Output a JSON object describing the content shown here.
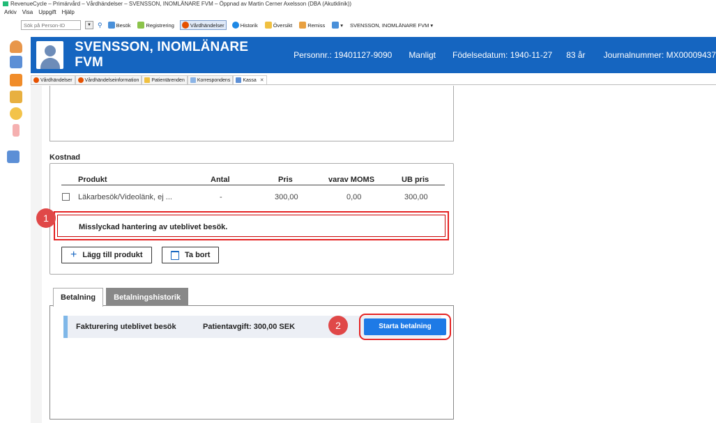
{
  "window": {
    "title": "RevenueCycle – Primärvård – Vårdhändelser – SVENSSON, INOMLÄNARE FVM – Öppnad av Martin Cerner Axelsson (DBA (Akutklinik))"
  },
  "menu": [
    "Arkiv",
    "Visa",
    "Uppgift",
    "Hjälp"
  ],
  "toolbar": {
    "search_placeholder": "Sök på Person-ID",
    "items": [
      "Besök",
      "Registrering",
      "Vårdhändelser",
      "Historik",
      "Översikt",
      "Remiss"
    ],
    "patient_selector": "SVENSSON, INOMLÄNARE FVM"
  },
  "header": {
    "name": "SVENSSON, INOMLÄNARE FVM",
    "personnr": "Personnr.: 19401127-9090",
    "gender": "Manligt",
    "birth": "Födelsedatum: 1940-11-27",
    "age": "83 år",
    "journal": "Journalnummer: MX00009437"
  },
  "tabs": [
    "Vårdhändelser",
    "Vårdhändelseinformation",
    "Patientärenden",
    "Korrespondens",
    "Kassa"
  ],
  "kostnad": {
    "title": "Kostnad",
    "headers": [
      "Produkt",
      "Antal",
      "Pris",
      "varav MOMS",
      "UB pris"
    ],
    "row": [
      "Läkarbesök/Videolänk, ej ...",
      "-",
      "300,00",
      "0,00",
      "300,00"
    ],
    "error": "Misslyckad hantering av uteblivet besök.",
    "add_label": "Lägg till produkt",
    "remove_label": "Ta bort"
  },
  "badges": [
    "1",
    "2"
  ],
  "betalning": {
    "tabs": [
      "Betalning",
      "Betalningshistorik"
    ],
    "item_label": "Fakturering uteblivet besök",
    "fee": "Patientavgift: 300,00 SEK",
    "start_label": "Starta betalning"
  },
  "colors": {
    "header_bg": "#1565c0",
    "accent": "#1e7ae6",
    "highlight": "#e52222"
  }
}
